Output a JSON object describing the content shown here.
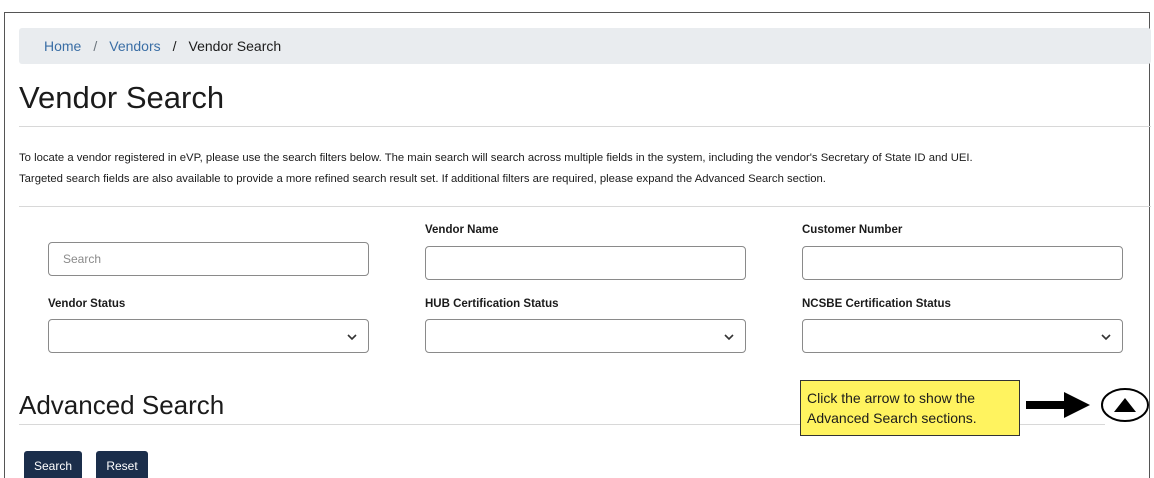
{
  "breadcrumb": {
    "home": "Home",
    "separator": "/",
    "vendors": "Vendors",
    "current": "Vendor Search"
  },
  "page": {
    "title": "Vendor Search",
    "intro_line1": "To locate a vendor registered in eVP, please use the search filters below. The main search will search across multiple fields in the system, including the vendor's Secretary of State ID and UEI.",
    "intro_line2": "Targeted search fields are also available to provide a more refined search result set. If additional filters are required, please expand the Advanced Search section."
  },
  "filters": {
    "search": {
      "placeholder": "Search",
      "value": ""
    },
    "vendor_name": {
      "label": "Vendor Name",
      "value": ""
    },
    "customer_number": {
      "label": "Customer Number",
      "value": ""
    },
    "vendor_status": {
      "label": "Vendor Status",
      "value": ""
    },
    "hub_status": {
      "label": "HUB Certification Status",
      "value": ""
    },
    "ncsbe_status": {
      "label": "NCSBE Certification Status",
      "value": ""
    }
  },
  "advanced": {
    "title": "Advanced Search",
    "toggle_icon": "chevron-up-icon"
  },
  "actions": {
    "search_label": "Search",
    "reset_label": "Reset"
  },
  "annotation": {
    "text_line1": "Click the arrow to show the",
    "text_line2": "Advanced Search sections.",
    "highlight_color": "#fff35f",
    "arrow_icon": "right-arrow-icon"
  },
  "colors": {
    "breadcrumb_bg": "#e9ecef",
    "link": "#3a6ea5",
    "button_bg": "#1b2e4b"
  }
}
